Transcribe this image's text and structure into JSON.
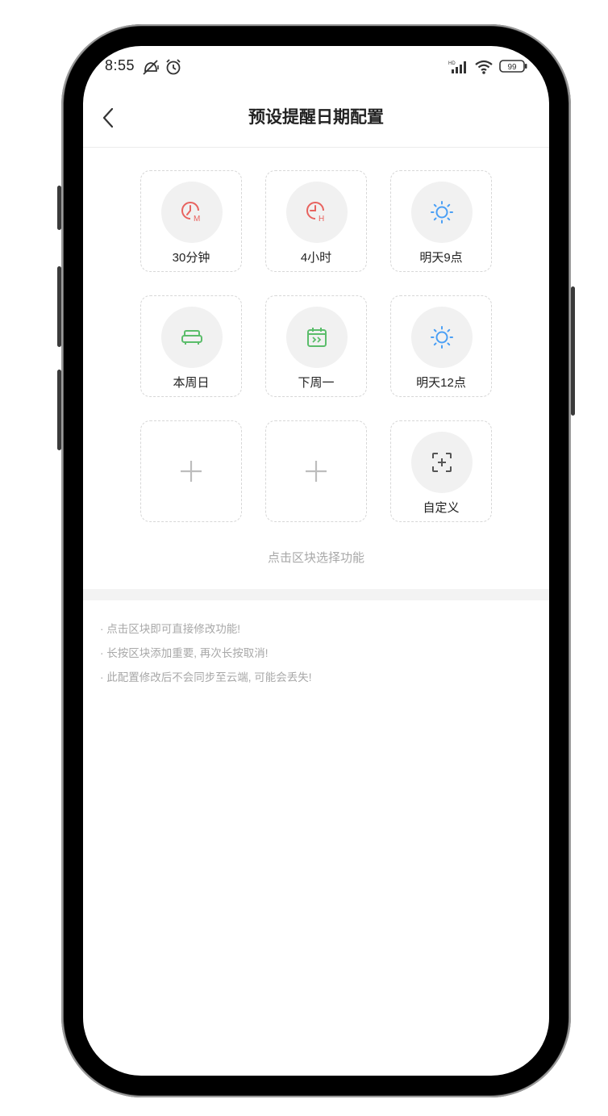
{
  "status_bar": {
    "time": "8:55",
    "battery": "99",
    "icons": [
      "mute-icon",
      "alarm-icon",
      "signal-icon",
      "wifi-icon",
      "battery-icon"
    ]
  },
  "header": {
    "title": "预设提醒日期配置",
    "back_icon": "chevron-left-icon"
  },
  "tiles": [
    {
      "label": "30分钟",
      "icon": "clock-m-icon",
      "color": "#e8635f"
    },
    {
      "label": "4小时",
      "icon": "clock-h-icon",
      "color": "#e8635f"
    },
    {
      "label": "明天9点",
      "icon": "sun-icon",
      "color": "#4a9ff5"
    },
    {
      "label": "本周日",
      "icon": "sofa-icon",
      "color": "#5bbd6b"
    },
    {
      "label": "下周一",
      "icon": "calendar-next-icon",
      "color": "#5bbd6b"
    },
    {
      "label": "明天12点",
      "icon": "sun-icon",
      "color": "#4a9ff5"
    },
    {
      "label": "",
      "icon": "plus-icon",
      "color": "#bdbdbd"
    },
    {
      "label": "",
      "icon": "plus-icon",
      "color": "#bdbdbd"
    },
    {
      "label": "自定义",
      "icon": "add-frame-icon",
      "color": "#555555"
    }
  ],
  "hint": "点击区块选择功能",
  "notes": [
    "· 点击区块即可直接修改功能!",
    "· 长按区块添加重要, 再次长按取消!",
    "· 此配置修改后不会同步至云端, 可能会丢失!"
  ]
}
